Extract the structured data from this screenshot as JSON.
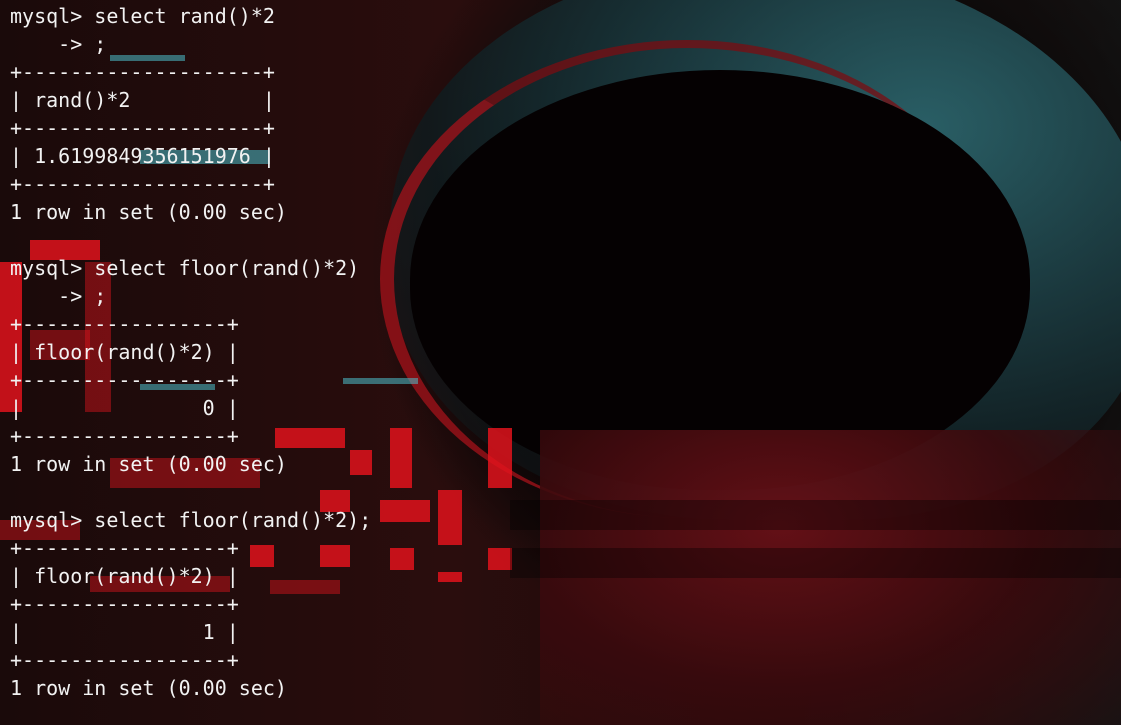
{
  "terminal": {
    "lines": [
      "mysql> select rand()*2",
      "    -> ;",
      "+--------------------+",
      "| rand()*2           |",
      "+--------------------+",
      "| 1.6199849356151976 |",
      "+--------------------+",
      "1 row in set (0.00 sec)",
      "",
      "mysql> select floor(rand()*2)",
      "    -> ;",
      "+-----------------+",
      "| floor(rand()*2) |",
      "+-----------------+",
      "|               0 |",
      "+-----------------+",
      "1 row in set (0.00 sec)",
      "",
      "mysql> select floor(rand()*2);",
      "+-----------------+",
      "| floor(rand()*2) |",
      "+-----------------+",
      "|               1 |",
      "+-----------------+",
      "1 row in set (0.00 sec)"
    ]
  },
  "background": {
    "description_icon": "hooded-hacker-image",
    "accent_red": "#e0131c",
    "accent_cyan": "#4cc0cc"
  }
}
